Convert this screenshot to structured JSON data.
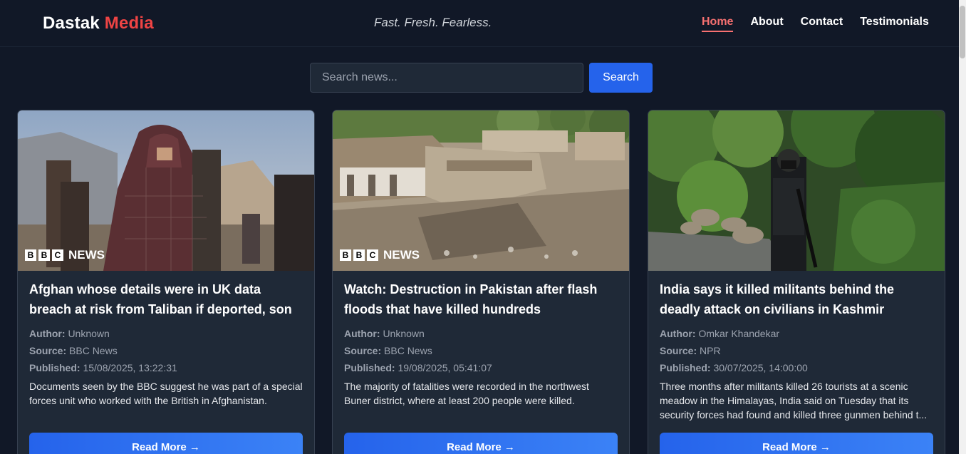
{
  "header": {
    "brand_main": "Dastak",
    "brand_accent": "Media",
    "tagline": "Fast. Fresh. Fearless.",
    "nav": [
      "Home",
      "About",
      "Contact",
      "Testimonials"
    ],
    "active_nav": "Home"
  },
  "search": {
    "placeholder": "Search news...",
    "value": "",
    "button_label": "Search"
  },
  "labels": {
    "author": "Author:",
    "source": "Source:",
    "published": "Published:"
  },
  "cards": [
    {
      "title": "Afghan whose details were in UK data breach at risk from Taliban if deported, son tells BBC",
      "author": "Unknown",
      "source": "BBC News",
      "published": "15/08/2025, 13:22:31",
      "description": "Documents seen by the BBC suggest he was part of a special forces unit who worked with the British in Afghanistan.",
      "watermark": "NEWS",
      "read_more": "Read More →"
    },
    {
      "title": "Watch: Destruction in Pakistan after flash floods that have killed hundreds",
      "author": "Unknown",
      "source": "BBC News",
      "published": "19/08/2025, 05:41:07",
      "description": "The majority of fatalities were recorded in the northwest Buner district, where at least 200 people were killed.",
      "watermark": "NEWS",
      "read_more": "Read More →"
    },
    {
      "title": "India says it killed militants behind the deadly attack on civilians in Kashmir",
      "author": "Omkar Khandekar",
      "source": "NPR",
      "published": "30/07/2025, 14:00:00",
      "description": "Three months after militants killed 26 tourists at a scenic meadow in the Himalayas, India said on Tuesday that its security forces had found and killed three gunmen behind t...",
      "read_more": "Read More →"
    }
  ],
  "colors": {
    "background": "#111827",
    "card": "#1f2937",
    "accent_red": "#ef4444",
    "button_blue": "#2563eb"
  }
}
